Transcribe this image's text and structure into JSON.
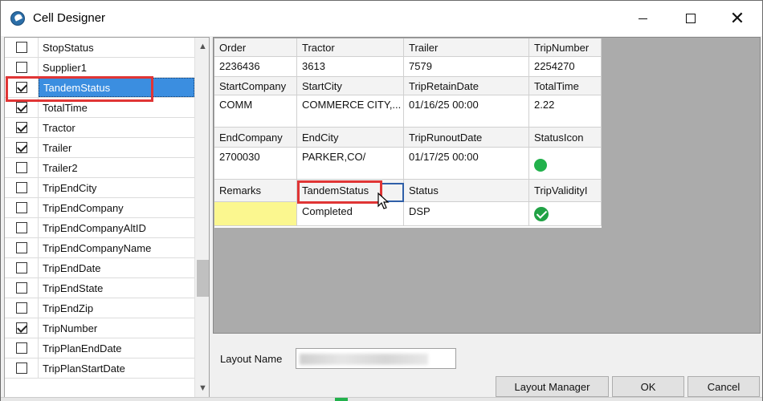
{
  "window": {
    "title": "Cell Designer"
  },
  "fields": [
    {
      "name": "StopStatus",
      "checked": false
    },
    {
      "name": "Supplier1",
      "checked": false
    },
    {
      "name": "TandemStatus",
      "checked": true,
      "selected": true
    },
    {
      "name": "TotalTime",
      "checked": true
    },
    {
      "name": "Tractor",
      "checked": true
    },
    {
      "name": "Trailer",
      "checked": true
    },
    {
      "name": "Trailer2",
      "checked": false
    },
    {
      "name": "TripEndCity",
      "checked": false
    },
    {
      "name": "TripEndCompany",
      "checked": false
    },
    {
      "name": "TripEndCompanyAltID",
      "checked": false
    },
    {
      "name": "TripEndCompanyName",
      "checked": false
    },
    {
      "name": "TripEndDate",
      "checked": false
    },
    {
      "name": "TripEndState",
      "checked": false
    },
    {
      "name": "TripEndZip",
      "checked": false
    },
    {
      "name": "TripNumber",
      "checked": true
    },
    {
      "name": "TripPlanEndDate",
      "checked": false
    },
    {
      "name": "TripPlanStartDate",
      "checked": false
    }
  ],
  "grid": {
    "h1": [
      "Order",
      "Tractor",
      "Trailer",
      "TripNumber"
    ],
    "v1": [
      "2236436",
      "3613",
      "7579",
      "2254270"
    ],
    "h2": [
      "StartCompany",
      "StartCity",
      "TripRetainDate",
      "TotalTime"
    ],
    "v2": [
      "COMM",
      "COMMERCE CITY,...",
      "01/16/25 00:00",
      "2.22"
    ],
    "h3": [
      "EndCompany",
      "EndCity",
      "TripRunoutDate",
      "StatusIcon"
    ],
    "v3": [
      "2700030",
      "PARKER,CO/",
      "01/17/25 00:00",
      ""
    ],
    "h4": [
      "Remarks",
      "TandemStatus",
      "Status",
      "TripValidityI"
    ],
    "v4": [
      "",
      "Completed",
      "DSP",
      ""
    ]
  },
  "status_icon_color": "#22b14c",
  "layout": {
    "label": "Layout Name"
  },
  "buttons": {
    "layout_manager": "Layout Manager",
    "ok": "OK",
    "cancel": "Cancel"
  }
}
